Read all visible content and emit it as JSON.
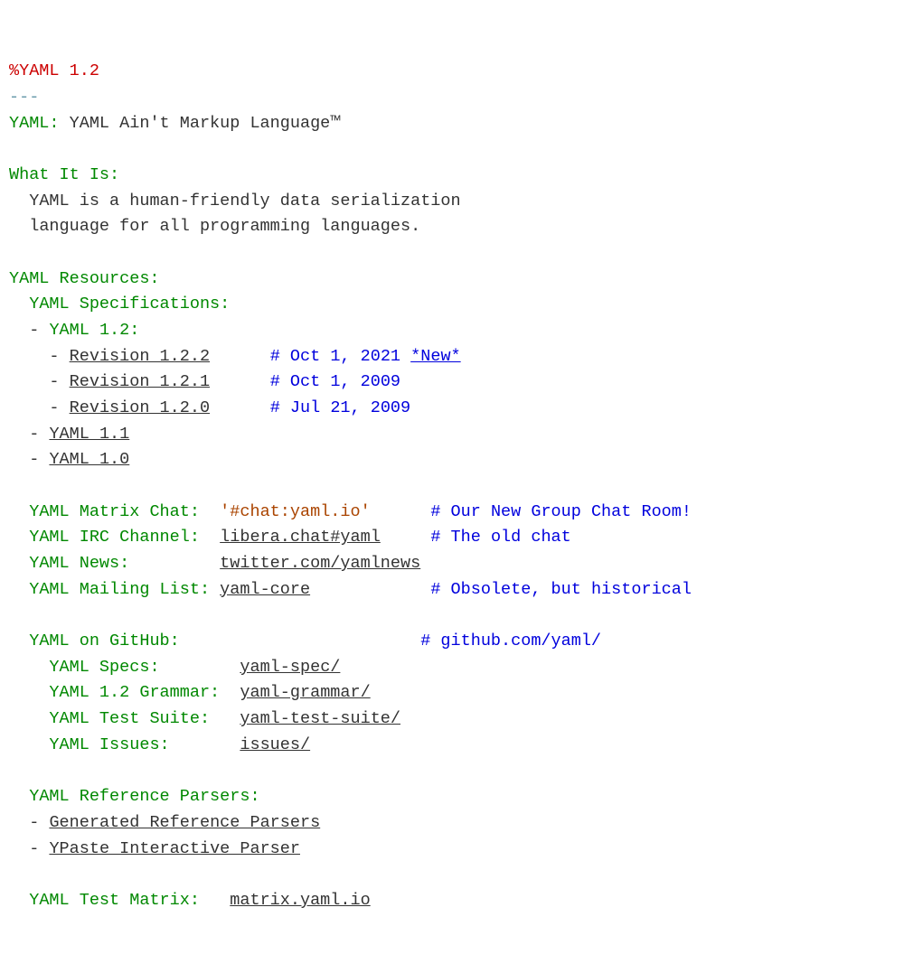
{
  "directive": "%YAML 1.2",
  "docstart": "---",
  "h1_key": "YAML:",
  "h1_val": "YAML Ain't Markup Language™",
  "what_key": "What It Is:",
  "what_l1": "YAML is a human-friendly data serialization",
  "what_l2": "language for all programming languages.",
  "res_key": "YAML Resources:",
  "spec_key": "YAML Specifications:",
  "v12_key": "YAML 1.2:",
  "rev122": "Revision 1.2.2",
  "rev122_c": "# Oct 1, 2021 ",
  "rev122_new": "*New*",
  "rev121": "Revision 1.2.1",
  "rev121_c": "# Oct 1, 2009",
  "rev120": "Revision 1.2.0",
  "rev120_c": "# Jul 21, 2009",
  "v11": "YAML 1.1",
  "v10": "YAML 1.0",
  "mx_key": "YAML Matrix Chat:",
  "mx_val": "'#chat:yaml.io'",
  "mx_c": "# Our New Group Chat Room!",
  "irc_key": "YAML IRC Channel:",
  "irc_val": "libera.chat#yaml",
  "irc_c": "# The old chat",
  "news_key": "YAML News:",
  "news_val": "twitter.com/yamlnews",
  "ml_key": "YAML Mailing List:",
  "ml_val": "yaml-core",
  "ml_c": "# Obsolete, but historical",
  "gh_key": "YAML on GitHub:",
  "gh_c": "# github.com/yaml/",
  "gh_specs_key": "YAML Specs:",
  "gh_specs_val": "yaml-spec/",
  "gh_gram_key": "YAML 1.2 Grammar:",
  "gh_gram_val": "yaml-grammar/",
  "gh_ts_key": "YAML Test Suite:",
  "gh_ts_val": "yaml-test-suite/",
  "gh_is_key": "YAML Issues:",
  "gh_is_val": "issues/",
  "rp_key": "YAML Reference Parsers:",
  "rp1": "Generated Reference Parsers",
  "rp2": "YPaste Interactive Parser",
  "tm_key": "YAML Test Matrix:",
  "tm_val": "matrix.yaml.io"
}
